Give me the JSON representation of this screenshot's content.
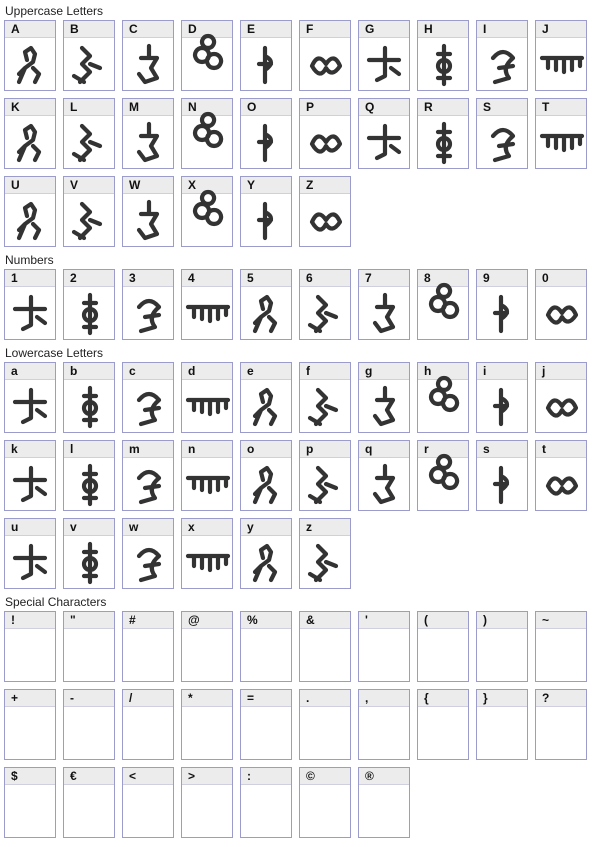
{
  "sections": {
    "uppercase": "Uppercase Letters",
    "numbers": "Numbers",
    "lowercase": "Lowercase Letters",
    "special": "Special Characters"
  },
  "uppercase_row1": [
    "A",
    "B",
    "C",
    "D",
    "E",
    "F",
    "G",
    "H",
    "I",
    "J"
  ],
  "uppercase_row2": [
    "K",
    "L",
    "M",
    "N",
    "O",
    "P",
    "Q",
    "R",
    "S",
    "T"
  ],
  "uppercase_row3": [
    "U",
    "V",
    "W",
    "X",
    "Y",
    "Z"
  ],
  "numbers_row": [
    "1",
    "2",
    "3",
    "4",
    "5",
    "6",
    "7",
    "8",
    "9",
    "0"
  ],
  "lowercase_row1": [
    "a",
    "b",
    "c",
    "d",
    "e",
    "f",
    "g",
    "h",
    "i",
    "j"
  ],
  "lowercase_row2": [
    "k",
    "l",
    "m",
    "n",
    "o",
    "p",
    "q",
    "r",
    "s",
    "t"
  ],
  "lowercase_row3": [
    "u",
    "v",
    "w",
    "x",
    "y",
    "z"
  ],
  "special_row1": [
    "!",
    "\"",
    "#",
    "@",
    "%",
    "&",
    "'",
    "(",
    ")",
    "~"
  ],
  "special_row2": [
    "+",
    "-",
    "/",
    "*",
    "=",
    ".",
    ",",
    "{",
    "}",
    "?"
  ],
  "special_row3": [
    "$",
    "€",
    "<",
    ">",
    ":",
    "©",
    "®"
  ]
}
